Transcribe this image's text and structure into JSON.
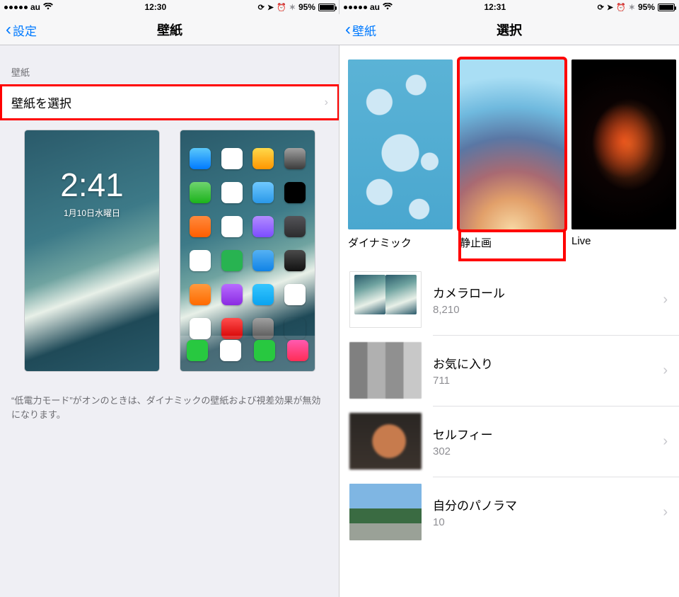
{
  "left": {
    "status": {
      "carrier": "au",
      "time": "12:30",
      "battery_pct": "95%"
    },
    "nav": {
      "back": "設定",
      "title": "壁紙"
    },
    "section_header": "壁紙",
    "choose_wallpaper": "壁紙を選択",
    "lock_preview": {
      "time": "2:41",
      "date": "1月10日水曜日"
    },
    "footnote": "“低電力モード”がオンのときは、ダイナミックの壁紙および視差効果が無効になります。"
  },
  "right": {
    "status": {
      "carrier": "au",
      "time": "12:31",
      "battery_pct": "95%"
    },
    "nav": {
      "back": "壁紙",
      "title": "選択"
    },
    "categories": [
      {
        "key": "dynamic",
        "label": "ダイナミック"
      },
      {
        "key": "still",
        "label": "静止画",
        "highlighted": true
      },
      {
        "key": "live",
        "label": "Live"
      }
    ],
    "albums": [
      {
        "key": "cameraroll",
        "name": "カメラロール",
        "count": "8,210"
      },
      {
        "key": "fav",
        "name": "お気に入り",
        "count": "711"
      },
      {
        "key": "selfie",
        "name": "セルフィー",
        "count": "302"
      },
      {
        "key": "pano",
        "name": "自分のパノラマ",
        "count": "10"
      }
    ]
  }
}
